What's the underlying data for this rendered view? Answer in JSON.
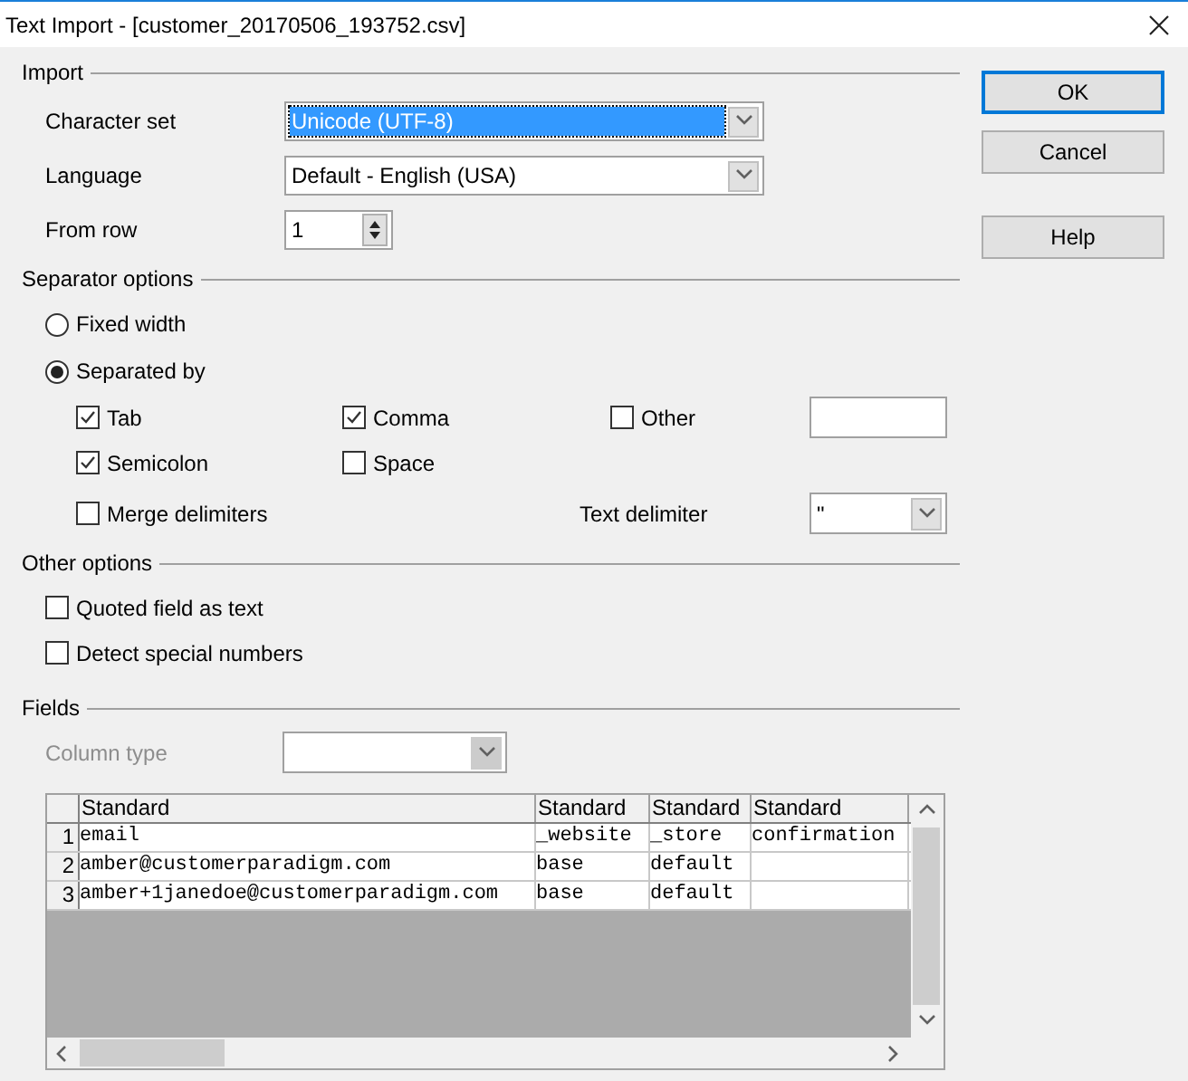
{
  "window": {
    "title": "Text Import - [customer_20170506_193752.csv]"
  },
  "import": {
    "heading": "Import",
    "character_set": {
      "label": "Character set",
      "value": "Unicode (UTF-8)",
      "focused": true
    },
    "language": {
      "label": "Language",
      "value": "Default - English (USA)",
      "focused": false
    },
    "from_row": {
      "label": "From row",
      "value": "1"
    }
  },
  "separator_options": {
    "heading": "Separator options",
    "modes": [
      {
        "label": "Fixed width",
        "selected": false
      },
      {
        "label": "Separated by",
        "selected": true
      }
    ],
    "separators": [
      {
        "label": "Tab",
        "checked": true
      },
      {
        "label": "Comma",
        "checked": true
      },
      {
        "label": "Other",
        "checked": false
      },
      {
        "label": "Semicolon",
        "checked": true
      },
      {
        "label": "Space",
        "checked": false
      }
    ],
    "merge_delimiters": {
      "label": "Merge delimiters",
      "checked": false
    },
    "text_delimiter": {
      "label": "Text delimiter",
      "value": "\""
    }
  },
  "other_options": {
    "heading": "Other options",
    "options": [
      {
        "label": "Quoted field as text",
        "checked": false
      },
      {
        "label": "Detect special numbers",
        "checked": false
      }
    ]
  },
  "fields": {
    "heading": "Fields",
    "column_type": {
      "label": "Column type",
      "disabled": true
    },
    "table": {
      "columns": [
        "Standard",
        "Standard",
        "Standard",
        "Standard"
      ],
      "rows": [
        {
          "number": "1",
          "cells": [
            "email",
            "_website",
            "_store",
            "confirmation"
          ]
        },
        {
          "number": "2",
          "cells": [
            "amber@customerparadigm.com",
            "base",
            "default",
            ""
          ]
        },
        {
          "number": "3",
          "cells": [
            "amber+1janedoe@customerparadigm.com",
            "base",
            "default",
            ""
          ]
        }
      ]
    }
  },
  "buttons": [
    "OK",
    "Cancel",
    "Help"
  ]
}
